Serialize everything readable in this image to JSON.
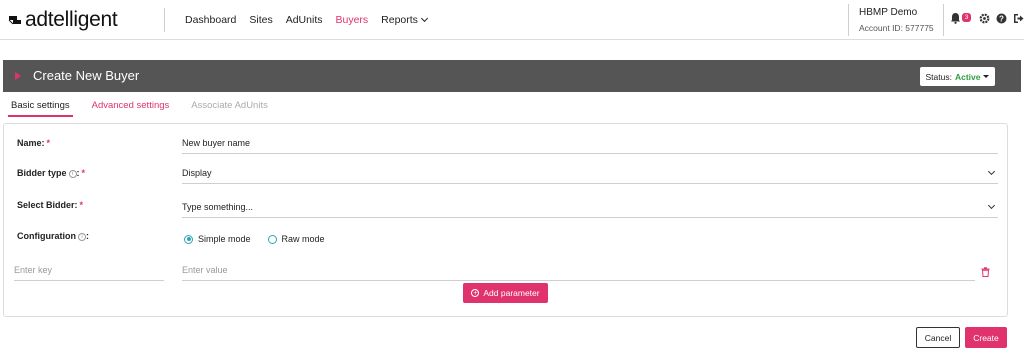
{
  "brand": {
    "logo_text": "adtelligent",
    "icon": "adtelligent-logo-icon",
    "accent": "#e0336d"
  },
  "nav": {
    "items": [
      "Dashboard",
      "Sites",
      "AdUnits",
      "Buyers",
      "Reports"
    ],
    "active": "Buyers"
  },
  "account": {
    "name": "HBMP Demo",
    "id_text": "Account ID: 577775"
  },
  "header_icons": {
    "notifications_count": "3",
    "icons": [
      "bell-icon",
      "gear-icon",
      "help-icon",
      "logout-icon"
    ]
  },
  "page": {
    "title": "Create New Buyer",
    "status_label": "Status:",
    "status_value": "Active",
    "status_color": "#2e9e3e"
  },
  "tabs": [
    "Basic settings",
    "Advanced settings",
    "Associate AdUnits"
  ],
  "form": {
    "name_label": "Name:",
    "name_value": "New buyer name",
    "bidder_type_label": "Bidder type",
    "bidder_type_value": "Display",
    "select_bidder_label": "Select Bidder:",
    "select_bidder_placeholder": "Type something...",
    "configuration_label": "Configuration",
    "modes": [
      "Simple mode",
      "Raw mode"
    ],
    "selected_mode": "Simple mode",
    "key_placeholder": "Enter key",
    "value_placeholder": "Enter value",
    "add_parameter_label": "Add parameter"
  },
  "footer": {
    "cancel_label": "Cancel",
    "create_label": "Create"
  }
}
